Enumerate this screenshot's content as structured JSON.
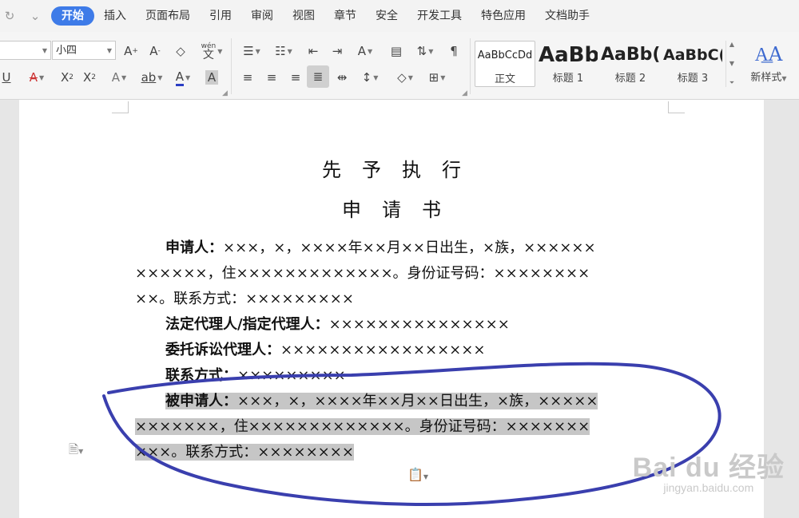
{
  "tabs": [
    "开始",
    "插入",
    "页面布局",
    "引用",
    "审阅",
    "视图",
    "章节",
    "安全",
    "开发工具",
    "特色应用",
    "文档助手"
  ],
  "active_tab": "开始",
  "ribbon": {
    "font_size": "小四",
    "styles": [
      {
        "preview": "AaBbCcDd",
        "label": "正文"
      },
      {
        "preview": "AaBb",
        "label": "标题 1"
      },
      {
        "preview": "AaBb(",
        "label": "标题 2"
      },
      {
        "preview": "AaBbC(",
        "label": "标题 3"
      }
    ],
    "new_style_label": "新样式",
    "phonetic_label": "wén",
    "phonetic_char": "文"
  },
  "document": {
    "title_line1": "先予执行",
    "title_line2": "申请书",
    "lines": [
      {
        "label": "申请人：",
        "text": "×××，×，××××年××月××日出生，×族，××××××"
      },
      {
        "label": "",
        "text": "××××××，住×××××××××××××。身份证号码：××××××××"
      },
      {
        "label": "",
        "text": "××。联系方式：×××××××××"
      },
      {
        "label": "法定代理人/指定代理人：",
        "text": "×××××××××××××××"
      },
      {
        "label": "委托诉讼代理人：",
        "text": "×××××××××××××××××"
      },
      {
        "label": "联系方式：",
        "text": "×××××××××"
      },
      {
        "label": "被申请人：",
        "text": "×××，×，××××年××月××日出生，×族，×××××"
      },
      {
        "label": "",
        "text": "×××××××，住×××××××××××××。身份证号码：×××××××"
      },
      {
        "label": "",
        "text": "×××。联系方式：××××××××"
      }
    ]
  },
  "watermark": {
    "big": "Bai du 经验",
    "small": "jingyan.baidu.com"
  },
  "annotation_color": "#3a3fae",
  "accent_color": "#3e7be8"
}
